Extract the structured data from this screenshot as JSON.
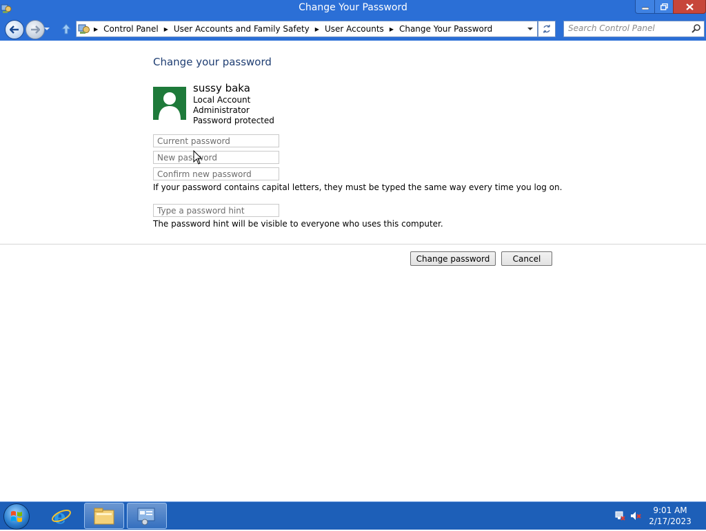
{
  "window": {
    "title": "Change Your Password"
  },
  "nav": {
    "breadcrumbs": [
      "Control Panel",
      "User Accounts and Family Safety",
      "User Accounts",
      "Change Your Password"
    ],
    "search_placeholder": "Search Control Panel"
  },
  "content": {
    "heading": "Change your password",
    "user": {
      "name": "sussy baka",
      "account_type": "Local Account",
      "role": "Administrator",
      "password_status": "Password protected"
    },
    "fields": {
      "current_password_placeholder": "Current password",
      "new_password_placeholder": "New password",
      "confirm_password_placeholder": "Confirm new password",
      "hint_placeholder": "Type a password hint"
    },
    "capital_letters_note": "If your password contains capital letters, they must be typed the same way every time you log on.",
    "hint_note": "The password hint will be visible to everyone who uses this computer.",
    "change_button": "Change password",
    "cancel_button": "Cancel"
  },
  "taskbar": {
    "time": "9:01 AM",
    "date": "2/17/2023",
    "items": [
      "internet-explorer-icon",
      "file-explorer-icon",
      "control-panel-icon"
    ]
  },
  "colors": {
    "titlebar": "#2b6fd6",
    "heading": "#1e3d72",
    "avatar": "#1e7a3a",
    "taskbar": "#1d5fb8"
  }
}
